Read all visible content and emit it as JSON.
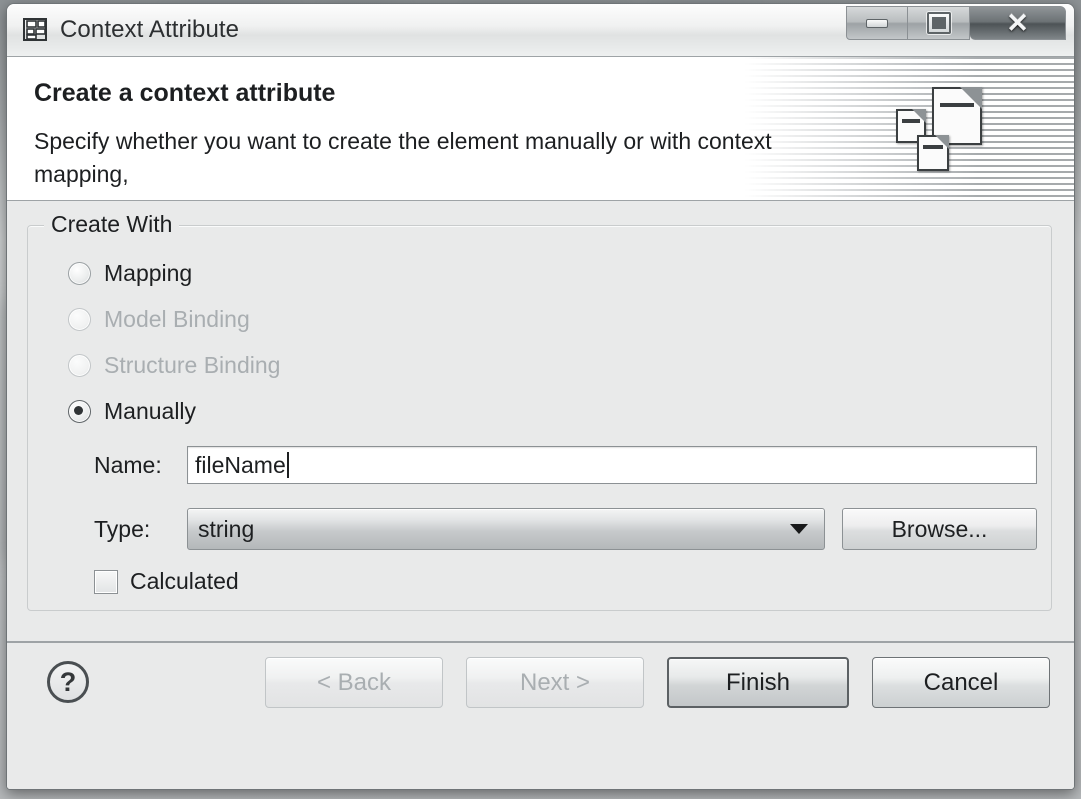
{
  "window": {
    "title": "Context Attribute",
    "title_icon": "structure-diagram-icon",
    "controls": {
      "minimize": "Minimize",
      "maximize": "Maximize",
      "close": "Close",
      "close_glyph": "✕"
    }
  },
  "banner": {
    "title": "Create a context attribute",
    "description": "Specify whether you want to create the element manually or with context mapping,",
    "icon": "documents-icon"
  },
  "group": {
    "legend": "Create With",
    "options": [
      {
        "label": "Mapping",
        "selected": false,
        "disabled": false
      },
      {
        "label": "Model Binding",
        "selected": false,
        "disabled": true
      },
      {
        "label": "Structure Binding",
        "selected": false,
        "disabled": true
      },
      {
        "label": "Manually",
        "selected": true,
        "disabled": false
      }
    ],
    "name_field": {
      "label": "Name:",
      "value": "fileName",
      "placeholder": ""
    },
    "type_field": {
      "label": "Type:",
      "value": "string",
      "options": [
        "string"
      ],
      "browse_label": "Browse..."
    },
    "calculated": {
      "label": "Calculated",
      "checked": false
    }
  },
  "footer": {
    "help_glyph": "?",
    "help_label": "Help",
    "buttons": [
      {
        "label": "< Back",
        "state": "disabled"
      },
      {
        "label": "Next >",
        "state": "disabled"
      },
      {
        "label": "Finish",
        "state": "default"
      },
      {
        "label": "Cancel",
        "state": "enabled"
      }
    ]
  },
  "colors": {
    "dialog_background": "#e9eaea",
    "banner_background": "#ffffff",
    "text": "#1d1f21",
    "disabled_text": "#a9aeb1",
    "border": "#9ea3a6"
  }
}
